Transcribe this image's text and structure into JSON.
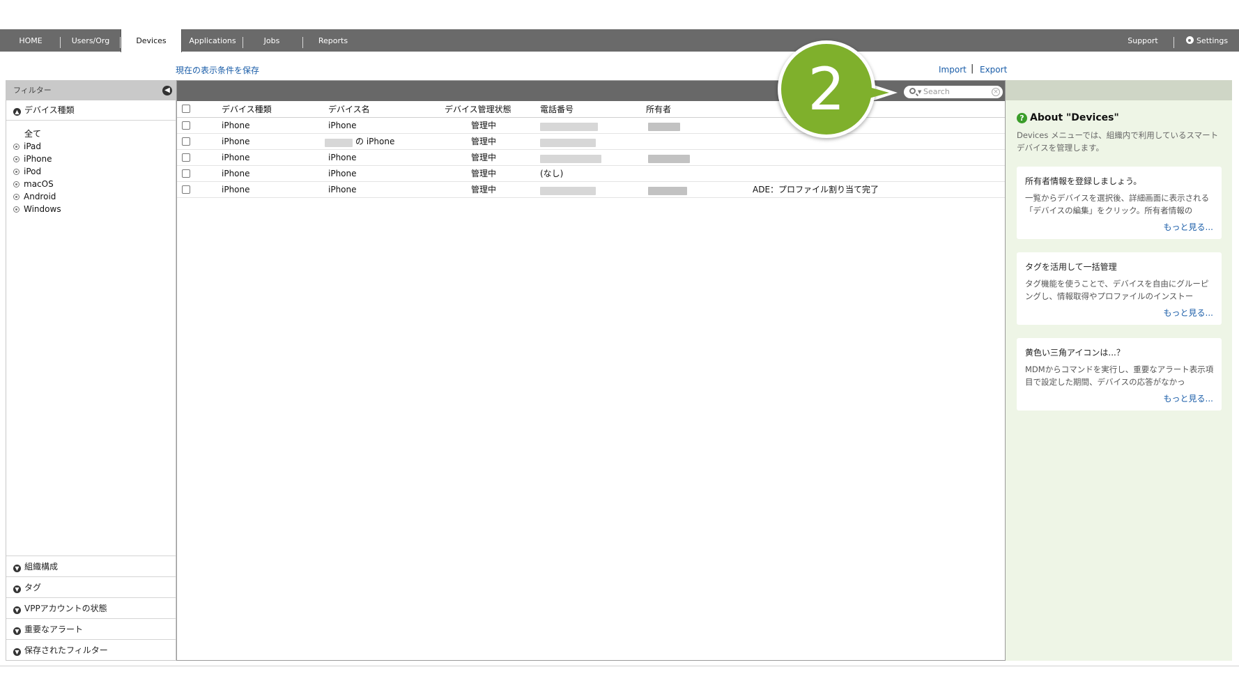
{
  "nav": {
    "tabs": [
      "HOME",
      "Users/Org",
      "Devices",
      "Applications",
      "Jobs",
      "Reports"
    ],
    "active_tab": "Devices",
    "support": "Support",
    "settings": "Settings"
  },
  "links": {
    "save_view": "現在の表示条件を保存",
    "import": "Import",
    "separator": "|",
    "export": "Export"
  },
  "filter": {
    "header": "フィルター",
    "device_type_group": "デバイス種類",
    "options": [
      "全て",
      "iPad",
      "iPhone",
      "iPod",
      "macOS",
      "Android",
      "Windows"
    ],
    "other_groups": [
      "組織構成",
      "タグ",
      "VPPアカウントの状態",
      "重要なアラート",
      "保存されたフィルター"
    ]
  },
  "search": {
    "placeholder": "Search"
  },
  "table": {
    "columns": [
      "デバイス種類",
      "デバイス名",
      "デバイス管理状態",
      "電話番号",
      "所有者"
    ],
    "rows": [
      {
        "type": "iPhone",
        "name": "iPhone",
        "status": "管理中",
        "phone": "",
        "owner": "",
        "note": ""
      },
      {
        "type": "iPhone",
        "name": "の iPhone",
        "status": "管理中",
        "phone": "",
        "owner": "",
        "note": ""
      },
      {
        "type": "iPhone",
        "name": "iPhone",
        "status": "管理中",
        "phone": "",
        "owner": "",
        "note": ""
      },
      {
        "type": "iPhone",
        "name": "iPhone",
        "status": "管理中",
        "phone": "(なし)",
        "owner": "",
        "note": ""
      },
      {
        "type": "iPhone",
        "name": "iPhone",
        "status": "管理中",
        "phone": "",
        "owner": "",
        "note": "ADE：プロファイル割り当て完了"
      }
    ]
  },
  "help": {
    "title": "About \"Devices\"",
    "description": "Devices メニューでは、組織内で利用しているスマートデバイスを管理します。",
    "cards": [
      {
        "title": "所有者情報を登録しましょう。",
        "text": "一覧からデバイスを選択後、詳細画面に表示される「デバイスの編集」をクリック。所有者情報の",
        "more": "もっと見る..."
      },
      {
        "title": "タグを活用して一括管理",
        "text": "タグ機能を使うことで、デバイスを自由にグルーピングし、情報取得やプロファイルのインストー",
        "more": "もっと見る..."
      },
      {
        "title": "黄色い三角アイコンは...？",
        "text": "MDMからコマンドを実行し、重要なアラート表示項目で設定した期間、デバイスの応答がなかっ",
        "more": "もっと見る..."
      }
    ]
  },
  "callout": {
    "number": "2"
  }
}
